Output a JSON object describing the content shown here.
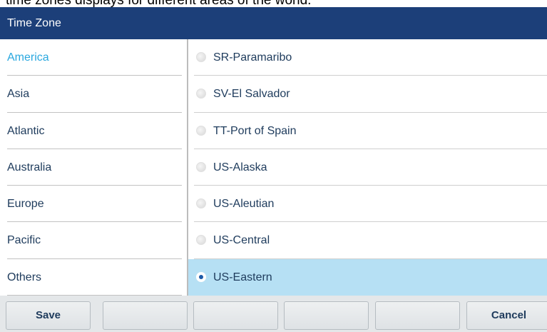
{
  "caption": "time zones displays for different areas of the world.",
  "window": {
    "title": "Time Zone"
  },
  "regions": [
    {
      "label": "America",
      "active": true
    },
    {
      "label": "Asia",
      "active": false
    },
    {
      "label": "Atlantic",
      "active": false
    },
    {
      "label": "Australia",
      "active": false
    },
    {
      "label": "Europe",
      "active": false
    },
    {
      "label": "Pacific",
      "active": false
    },
    {
      "label": "Others",
      "active": false
    }
  ],
  "zones": [
    {
      "label": "SR-Paramaribo",
      "selected": false
    },
    {
      "label": "SV-El Salvador",
      "selected": false
    },
    {
      "label": "TT-Port of Spain",
      "selected": false
    },
    {
      "label": "US-Alaska",
      "selected": false
    },
    {
      "label": "US-Aleutian",
      "selected": false
    },
    {
      "label": "US-Central",
      "selected": false
    },
    {
      "label": "US-Eastern",
      "selected": true
    }
  ],
  "softkeys": [
    "Save",
    "",
    "",
    "",
    "",
    "Cancel"
  ],
  "colors": {
    "titlebar": "#1c3f79",
    "active_region": "#2aa8df",
    "selected_row": "#b6e0f4",
    "text": "#1e3b5c"
  }
}
